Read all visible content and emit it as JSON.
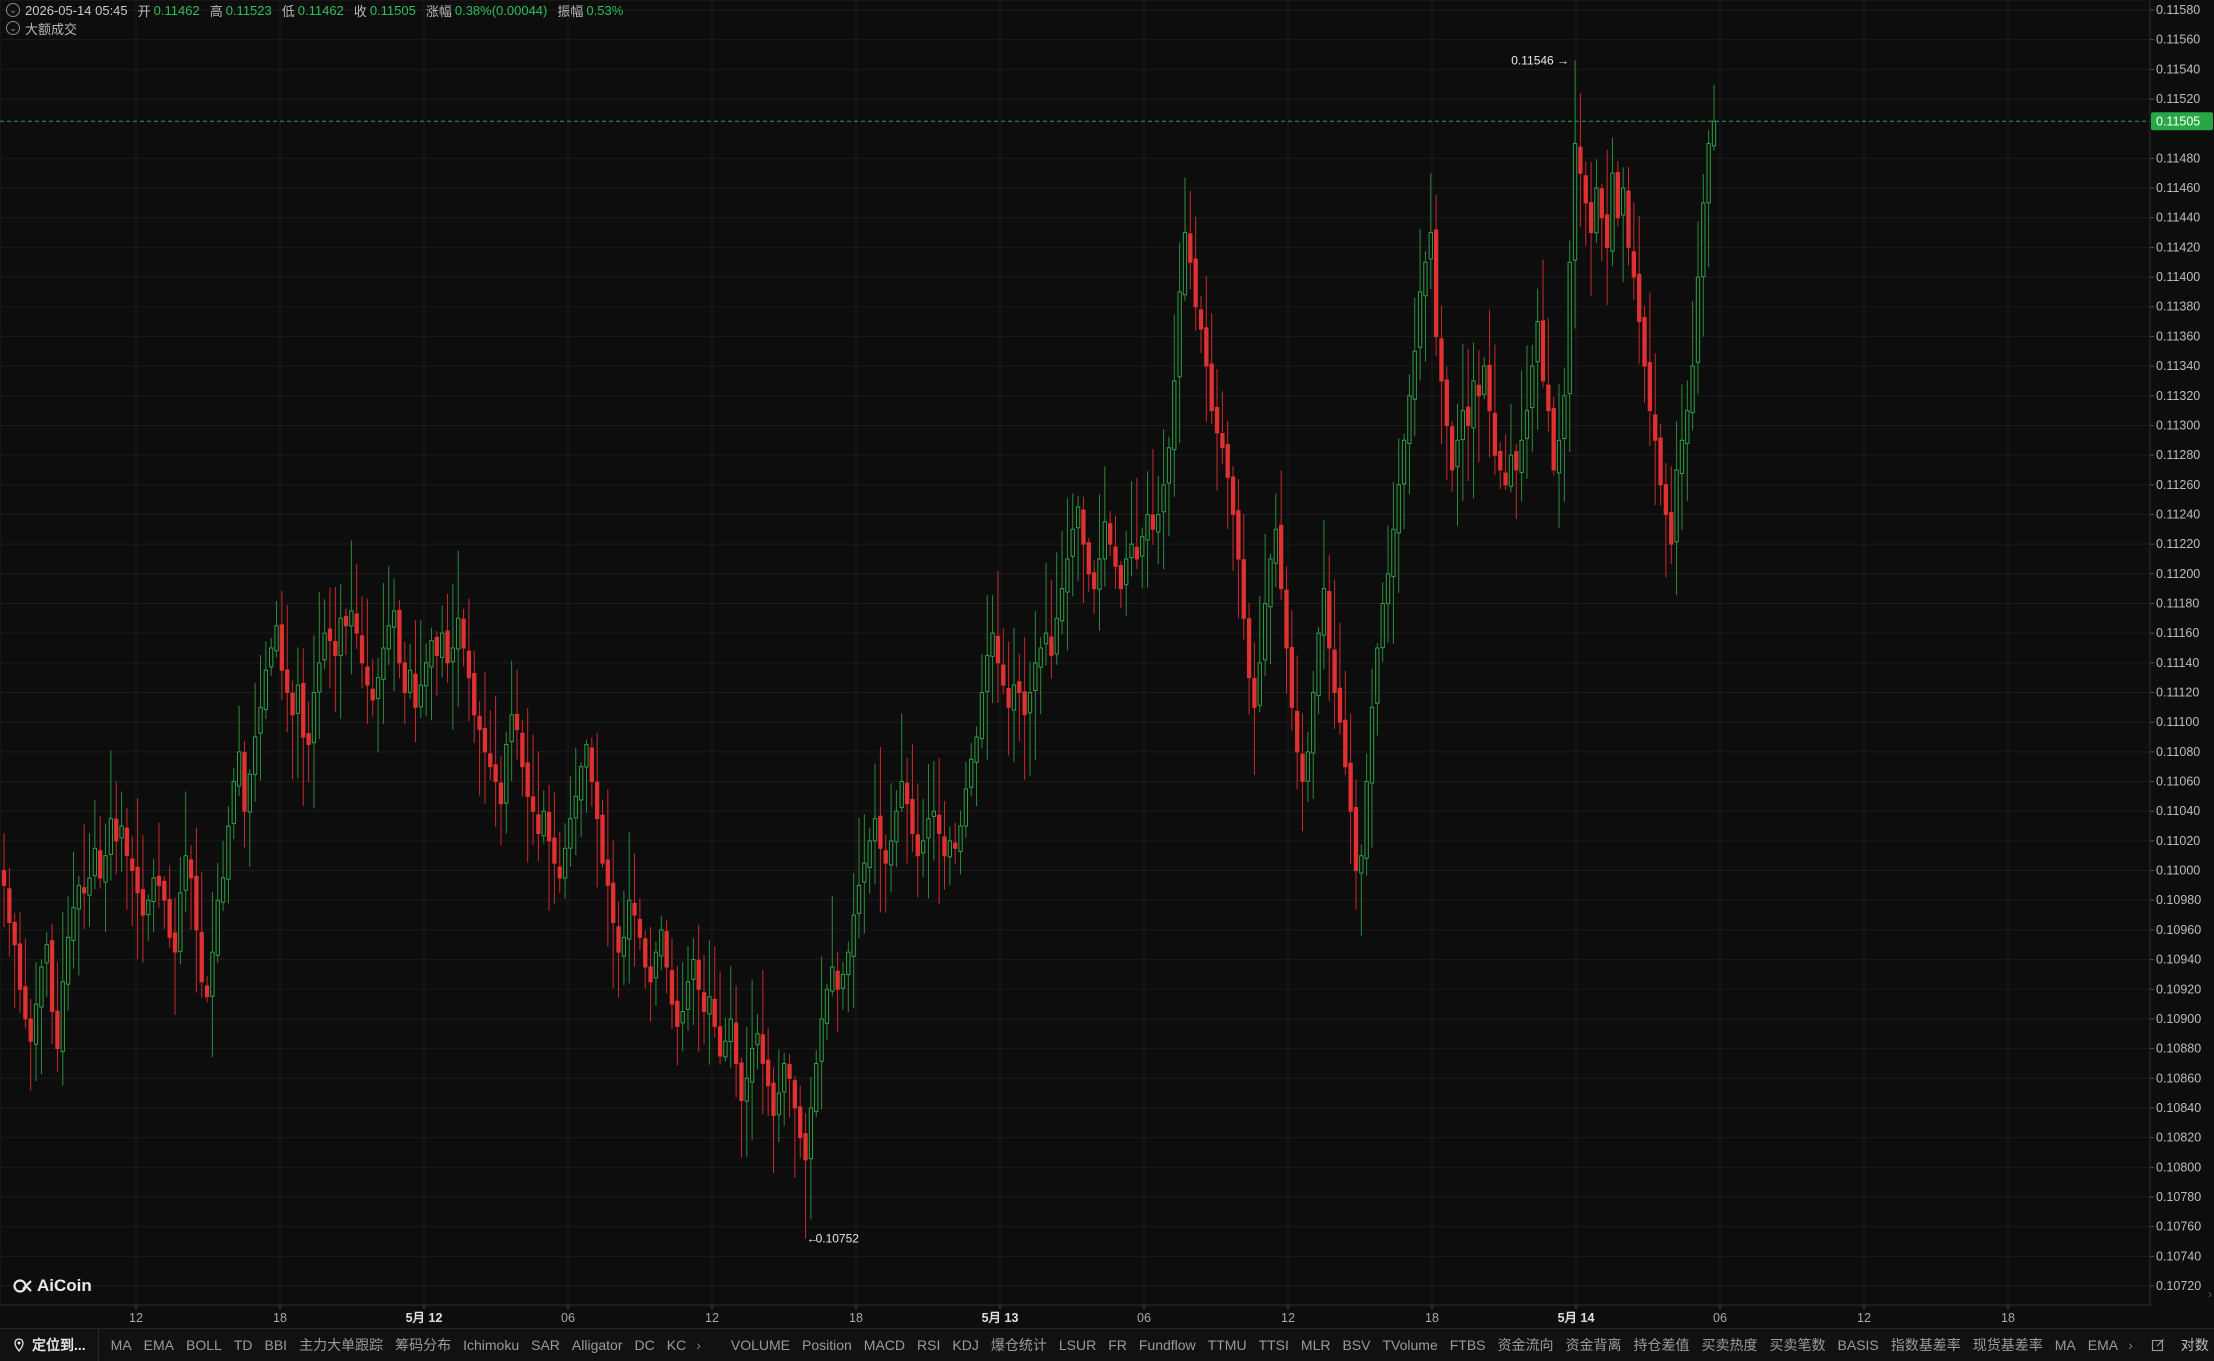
{
  "legend": {
    "datetime": "2026-05-14 05:45",
    "open_label": "开",
    "open": "0.11462",
    "high_label": "高",
    "high": "0.11523",
    "low_label": "低",
    "low": "0.11462",
    "close_label": "收",
    "close": "0.11505",
    "change_label": "涨幅",
    "change": "0.38%(0.00044)",
    "amplitude_label": "振幅",
    "amplitude": "0.53%",
    "big_trades_label": "大额成交"
  },
  "price_axis": {
    "ticks": [
      "0.11580",
      "0.11560",
      "0.11540",
      "0.11520",
      "0.11480",
      "0.11460",
      "0.11440",
      "0.11420",
      "0.11400",
      "0.11380",
      "0.11360",
      "0.11340",
      "0.11320",
      "0.11300",
      "0.11280",
      "0.11260",
      "0.11240",
      "0.11220",
      "0.11200",
      "0.11180",
      "0.11160",
      "0.11140",
      "0.11120",
      "0.11100",
      "0.11080",
      "0.11060",
      "0.11040",
      "0.11020",
      "0.11000",
      "0.10980",
      "0.10960",
      "0.10940",
      "0.10920",
      "0.10900",
      "0.10880",
      "0.10860",
      "0.10840",
      "0.10820",
      "0.10800",
      "0.10780",
      "0.10760",
      "0.10740",
      "0.10720"
    ],
    "current_price": "0.11505"
  },
  "time_axis": {
    "ticks": [
      "12",
      "18",
      "5月 12",
      "06",
      "12",
      "18",
      "5月 13",
      "06",
      "12",
      "18",
      "5月 14",
      "06",
      "12",
      "18"
    ],
    "major": [
      "5月 12",
      "5月 13",
      "5月 14"
    ]
  },
  "annotations": {
    "high_label": "0.11546",
    "low_label": "0.10752"
  },
  "chart_data": {
    "type": "candlestick",
    "y_range": [
      0.1071,
      0.1159
    ],
    "high_marker": 0.11546,
    "low_marker": 0.10752,
    "last_price": 0.11505,
    "closes": [
      0.1099,
      0.10965,
      0.1095,
      0.1092,
      0.109,
      0.10885,
      0.1091,
      0.10935,
      0.1095,
      0.10905,
      0.1088,
      0.10925,
      0.10955,
      0.10975,
      0.1099,
      0.10985,
      0.10995,
      0.11015,
      0.10995,
      0.1101,
      0.11035,
      0.1102,
      0.1103,
      0.1101,
      0.11,
      0.10985,
      0.1097,
      0.1098,
      0.10995,
      0.1099,
      0.1098,
      0.10955,
      0.10945,
      0.10985,
      0.1101,
      0.10995,
      0.1096,
      0.10925,
      0.10915,
      0.10945,
      0.1098,
      0.10995,
      0.1103,
      0.1106,
      0.1108,
      0.1104,
      0.11065,
      0.1109,
      0.1111,
      0.11135,
      0.1115,
      0.11165,
      0.11135,
      0.1112,
      0.11105,
      0.11125,
      0.1109,
      0.11085,
      0.1112,
      0.1114,
      0.1116,
      0.11155,
      0.11145,
      0.1117,
      0.11165,
      0.11175,
      0.1116,
      0.1114,
      0.11125,
      0.11115,
      0.1113,
      0.1115,
      0.11165,
      0.11175,
      0.1114,
      0.1112,
      0.11135,
      0.1111,
      0.11125,
      0.1114,
      0.11155,
      0.11145,
      0.1116,
      0.1114,
      0.1115,
      0.1117,
      0.1115,
      0.1113,
      0.11105,
      0.11095,
      0.1108,
      0.1107,
      0.1106,
      0.11045,
      0.11085,
      0.11105,
      0.11095,
      0.1107,
      0.1105,
      0.1104,
      0.11025,
      0.1104,
      0.1102,
      0.11005,
      0.10995,
      0.11015,
      0.11035,
      0.1105,
      0.1107,
      0.11085,
      0.1106,
      0.11035,
      0.11005,
      0.1099,
      0.10965,
      0.10945,
      0.10955,
      0.1098,
      0.1097,
      0.10955,
      0.10935,
      0.10925,
      0.10945,
      0.1096,
      0.10935,
      0.1091,
      0.10895,
      0.10905,
      0.10925,
      0.1094,
      0.1092,
      0.10905,
      0.10915,
      0.10895,
      0.10875,
      0.10885,
      0.109,
      0.1087,
      0.10845,
      0.1086,
      0.1088,
      0.1089,
      0.1087,
      0.10855,
      0.10835,
      0.1085,
      0.1087,
      0.1086,
      0.1084,
      0.1082,
      0.10805,
      0.1084,
      0.1087,
      0.109,
      0.1092,
      0.10935,
      0.1092,
      0.1093,
      0.10945,
      0.1097,
      0.1099,
      0.11005,
      0.1102,
      0.11035,
      0.11015,
      0.11005,
      0.1102,
      0.1104,
      0.1106,
      0.11045,
      0.11025,
      0.1101,
      0.1102,
      0.11035,
      0.1104,
      0.11025,
      0.1101,
      0.1102,
      0.11015,
      0.1103,
      0.11055,
      0.11075,
      0.1109,
      0.1112,
      0.11145,
      0.1116,
      0.1114,
      0.11125,
      0.1111,
      0.11125,
      0.1112,
      0.11105,
      0.1112,
      0.1114,
      0.1115,
      0.1116,
      0.11145,
      0.1117,
      0.1119,
      0.1121,
      0.1123,
      0.11245,
      0.1122,
      0.112,
      0.1119,
      0.1121,
      0.11235,
      0.1122,
      0.11205,
      0.1119,
      0.1121,
      0.1122,
      0.1121,
      0.11225,
      0.1124,
      0.1123,
      0.1124,
      0.1126,
      0.11285,
      0.1133,
      0.1139,
      0.1143,
      0.1141,
      0.1138,
      0.11365,
      0.1134,
      0.1131,
      0.11295,
      0.11285,
      0.11265,
      0.1124,
      0.1121,
      0.1117,
      0.1113,
      0.1111,
      0.1114,
      0.1118,
      0.1121,
      0.1123,
      0.1119,
      0.1115,
      0.1111,
      0.1108,
      0.1106,
      0.1108,
      0.1112,
      0.1116,
      0.1119,
      0.1115,
      0.1112,
      0.111,
      0.1107,
      0.1104,
      0.11,
      0.1101,
      0.1106,
      0.1111,
      0.1115,
      0.1118,
      0.112,
      0.1123,
      0.1126,
      0.1129,
      0.1132,
      0.1135,
      0.1139,
      0.1141,
      0.1143,
      0.1136,
      0.1133,
      0.113,
      0.1127,
      0.1129,
      0.1131,
      0.113,
      0.1133,
      0.1132,
      0.1134,
      0.1131,
      0.1128,
      0.1127,
      0.1126,
      0.1128,
      0.1127,
      0.1129,
      0.1131,
      0.1134,
      0.1137,
      0.1133,
      0.1131,
      0.1127,
      0.1129,
      0.1132,
      0.1141,
      0.1149,
      0.1147,
      0.1145,
      0.1143,
      0.1146,
      0.1144,
      0.1142,
      0.1147,
      0.1144,
      0.1146,
      0.1142,
      0.114,
      0.1137,
      0.1134,
      0.1131,
      0.1129,
      0.1126,
      0.1124,
      0.1122,
      0.1127,
      0.1129,
      0.1131,
      0.1134,
      0.114,
      0.1145,
      0.1149,
      0.11505
    ]
  }
}
